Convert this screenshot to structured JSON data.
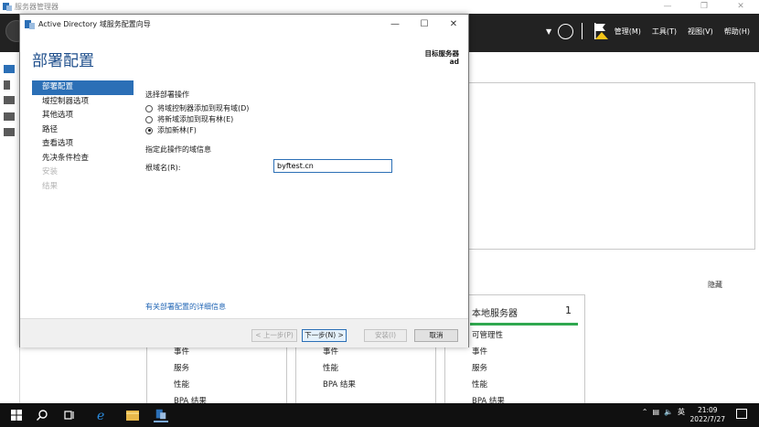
{
  "server_manager": {
    "title": "服务器管理器",
    "menu": [
      "管理(M)",
      "工具(T)",
      "视图(V)",
      "帮助(H)"
    ],
    "hide_label": "隐藏",
    "tiles": [
      {
        "title": "",
        "count": "",
        "items": [
          "事件",
          "服务",
          "性能",
          "BPA 结果"
        ]
      },
      {
        "title": "",
        "count": "",
        "items": [
          "事件",
          "性能",
          "BPA 结果"
        ]
      },
      {
        "title": "本地服务器",
        "count": "1",
        "items": [
          "可管理性",
          "事件",
          "服务",
          "性能",
          "BPA 结果"
        ]
      }
    ]
  },
  "wizard": {
    "title": "Active Directory 域服务配置向导",
    "page_heading": "部署配置",
    "target_server_label": "目标服务器",
    "target_server_value": "ad",
    "nav": [
      {
        "label": "部署配置",
        "state": "active"
      },
      {
        "label": "域控制器选项",
        "state": "normal"
      },
      {
        "label": "其他选项",
        "state": "normal"
      },
      {
        "label": "路径",
        "state": "normal"
      },
      {
        "label": "查看选项",
        "state": "normal"
      },
      {
        "label": "先决条件检查",
        "state": "normal"
      },
      {
        "label": "安装",
        "state": "disabled"
      },
      {
        "label": "结果",
        "state": "disabled"
      }
    ],
    "select_operation_label": "选择部署操作",
    "options": [
      {
        "label": "将域控制器添加到现有域(D)",
        "checked": false
      },
      {
        "label": "将新域添加到现有林(E)",
        "checked": false
      },
      {
        "label": "添加新林(F)",
        "checked": true
      }
    ],
    "domain_info_label": "指定此操作的域信息",
    "root_domain_label": "根域名(R):",
    "root_domain_value": "byftest.cn",
    "more_info_link": "有关部署配置的详细信息",
    "buttons": {
      "prev": "< 上一步(P)",
      "next": "下一步(N) >",
      "install": "安装(I)",
      "cancel": "取消"
    }
  },
  "taskbar": {
    "time": "21:09",
    "date": "2022/7/27",
    "ime": "英"
  },
  "colors": {
    "accent": "#2b6fb6",
    "heading": "#1f4f8c",
    "tile_bar": "#2fa84f",
    "header_bg": "#222222"
  }
}
